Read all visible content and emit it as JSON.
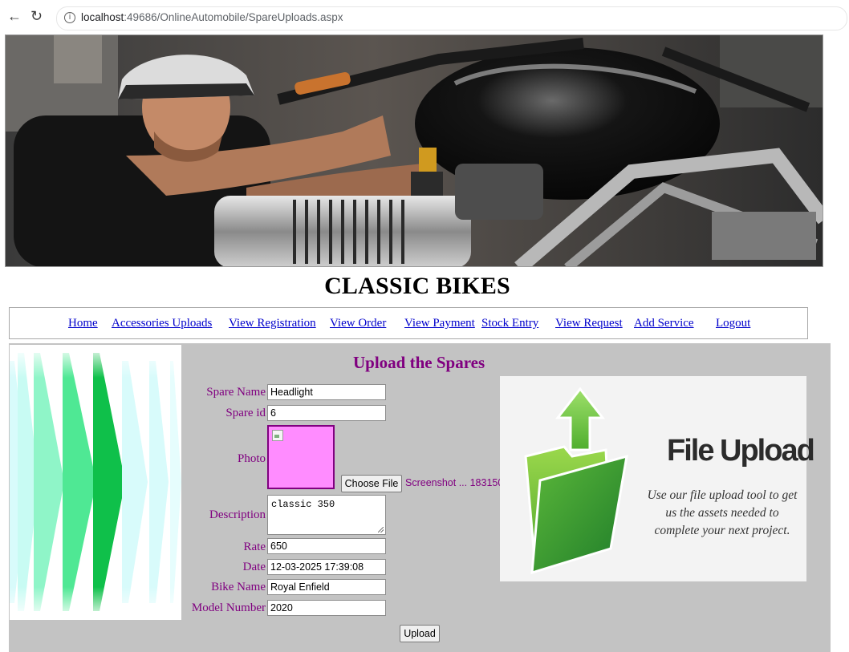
{
  "browser": {
    "url_host": "localhost",
    "url_rest": ":49686/OnlineAutomobile/SpareUploads.aspx"
  },
  "site": {
    "title": "CLASSIC BIKES"
  },
  "menu": {
    "home": "Home",
    "accessories_uploads": "Accessories Uploads",
    "view_registration": "View Registration",
    "view_order": "View Order",
    "view_payment": "View Payment",
    "stock_entry": "Stock Entry",
    "view_request": "View Request",
    "add_service": "Add Service",
    "logout": "Logout"
  },
  "form": {
    "title": "Upload the Spares",
    "spare_name": {
      "label": "Spare Name",
      "value": "Headlight"
    },
    "spare_id": {
      "label": "Spare id",
      "value": "6"
    },
    "photo": {
      "label": "Photo",
      "choose_label": "Choose File",
      "file_name": "Screenshot ... 183150"
    },
    "description": {
      "label": "Description",
      "value": "classic 350"
    },
    "rate": {
      "label": "Rate",
      "value": "650"
    },
    "date": {
      "label": "Date",
      "value": "12-03-2025 17:39:08"
    },
    "bike_name": {
      "label": "Bike Name",
      "value": "Royal Enfield"
    },
    "model_number": {
      "label": "Model Number",
      "value": "2020"
    },
    "upload_label": "Upload"
  },
  "file_upload_image": {
    "title": "File Upload",
    "subtitle": "Use our file upload tool to get us the assets needed to complete your next project."
  },
  "colors": {
    "accent": "#800080",
    "photo_bg": "#ff8cff",
    "panel_bg": "#c3c3c3",
    "link": "#0000cc"
  }
}
